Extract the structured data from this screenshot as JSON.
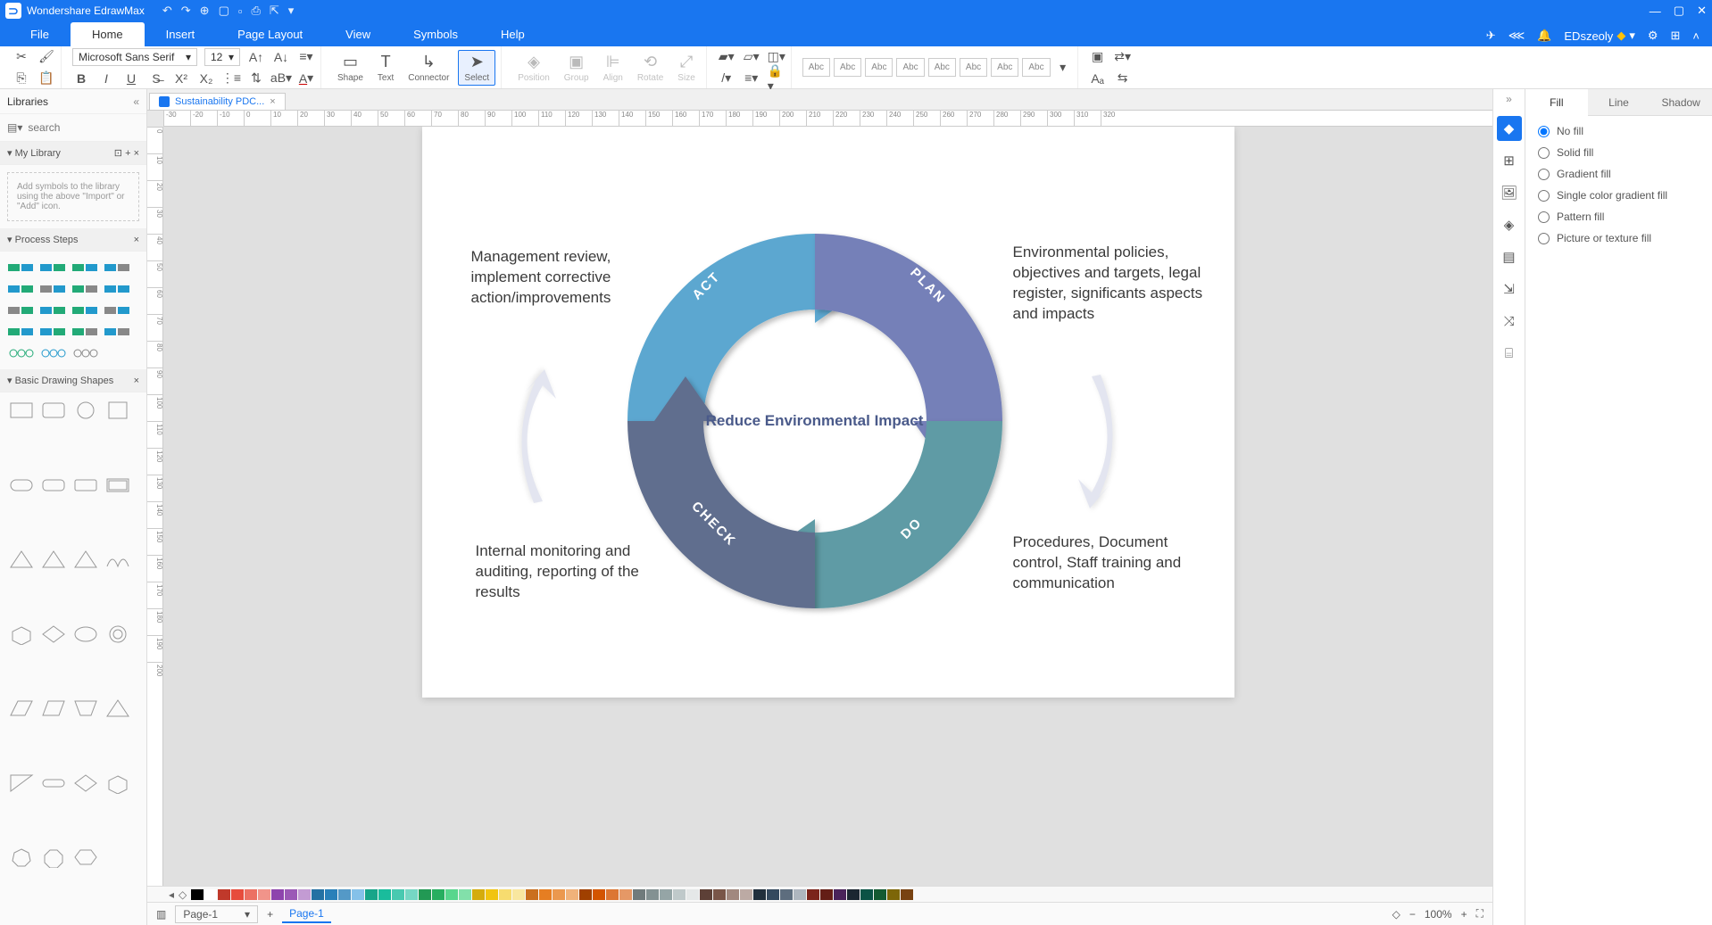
{
  "app": {
    "title": "Wondershare EdrawMax"
  },
  "menu": {
    "items": [
      "File",
      "Home",
      "Insert",
      "Page Layout",
      "View",
      "Symbols",
      "Help"
    ],
    "active": 1
  },
  "user": {
    "name": "EDszeoly"
  },
  "ribbon": {
    "font": "Microsoft Sans Serif",
    "fontsize": "12",
    "toolLabels": {
      "shape": "Shape",
      "text": "Text",
      "connector": "Connector",
      "select": "Select",
      "position": "Position",
      "group": "Group",
      "align": "Align",
      "rotate": "Rotate",
      "size": "Size"
    },
    "abc": "Abc"
  },
  "leftpanel": {
    "title": "Libraries",
    "search_placeholder": "search",
    "mylibrary": "My Library",
    "import_hint": "Add symbols to the library using the above \"Import\" or \"Add\" icon.",
    "process_steps": "Process Steps",
    "basic_shapes": "Basic Drawing Shapes"
  },
  "document": {
    "tab": "Sustainability PDC...",
    "page_label": "Page-1"
  },
  "diagram": {
    "center": "Reduce Environmental Impact",
    "labels": {
      "plan": "PLAN",
      "do": "DO",
      "check": "CHECK",
      "act": "ACT"
    },
    "desc_plan": "Environmental policies, objectives and targets, legal register, significants aspects and impacts",
    "desc_do": "Procedures, Document control, Staff training and communication",
    "desc_check": "Internal monitoring and auditing, reporting of the results",
    "desc_act": "Management review, implement corrective action/improvements"
  },
  "right": {
    "tabs": [
      "Fill",
      "Line",
      "Shadow"
    ],
    "fills": [
      "No fill",
      "Solid fill",
      "Gradient fill",
      "Single color gradient fill",
      "Pattern fill",
      "Picture or texture fill"
    ]
  },
  "bottom": {
    "zoom": "100%"
  },
  "ruler_h": [
    -30,
    -20,
    -10,
    0,
    10,
    20,
    30,
    40,
    50,
    60,
    70,
    80,
    90,
    100,
    110,
    120,
    130,
    140,
    150,
    160,
    170,
    180,
    190,
    200,
    210,
    220,
    230,
    240,
    250,
    260,
    270,
    280,
    290,
    300,
    310,
    320
  ],
  "ruler_v": [
    0,
    10,
    20,
    30,
    40,
    50,
    60,
    70,
    80,
    90,
    100,
    110,
    120,
    130,
    140,
    150,
    160,
    170,
    180,
    190,
    200
  ],
  "swatch_colors": [
    "#000",
    "#fff",
    "#c0392b",
    "#e74c3c",
    "#ec7063",
    "#f1948a",
    "#8e44ad",
    "#9b59b6",
    "#c39bd3",
    "#2471a3",
    "#2980b9",
    "#5499c7",
    "#85c1e9",
    "#17a589",
    "#1abc9c",
    "#48c9b0",
    "#76d7c4",
    "#229954",
    "#27ae60",
    "#58d68d",
    "#82e0aa",
    "#d4ac0d",
    "#f1c40f",
    "#f7dc6f",
    "#f9e79f",
    "#ca6f1e",
    "#e67e22",
    "#eb984e",
    "#f0b27a",
    "#a04000",
    "#d35400",
    "#dc7633",
    "#e59866",
    "#707b7c",
    "#839192",
    "#95a5a6",
    "#bfc9ca",
    "#e5e8e8",
    "#5d4037",
    "#795548",
    "#a1887f",
    "#bcaaa4",
    "#212f3c",
    "#34495e",
    "#5d6d7e",
    "#aeb6bf",
    "#7b241c",
    "#641e16",
    "#4a235a",
    "#1b2631",
    "#0b5345",
    "#145a32",
    "#7d6608",
    "#784212"
  ]
}
